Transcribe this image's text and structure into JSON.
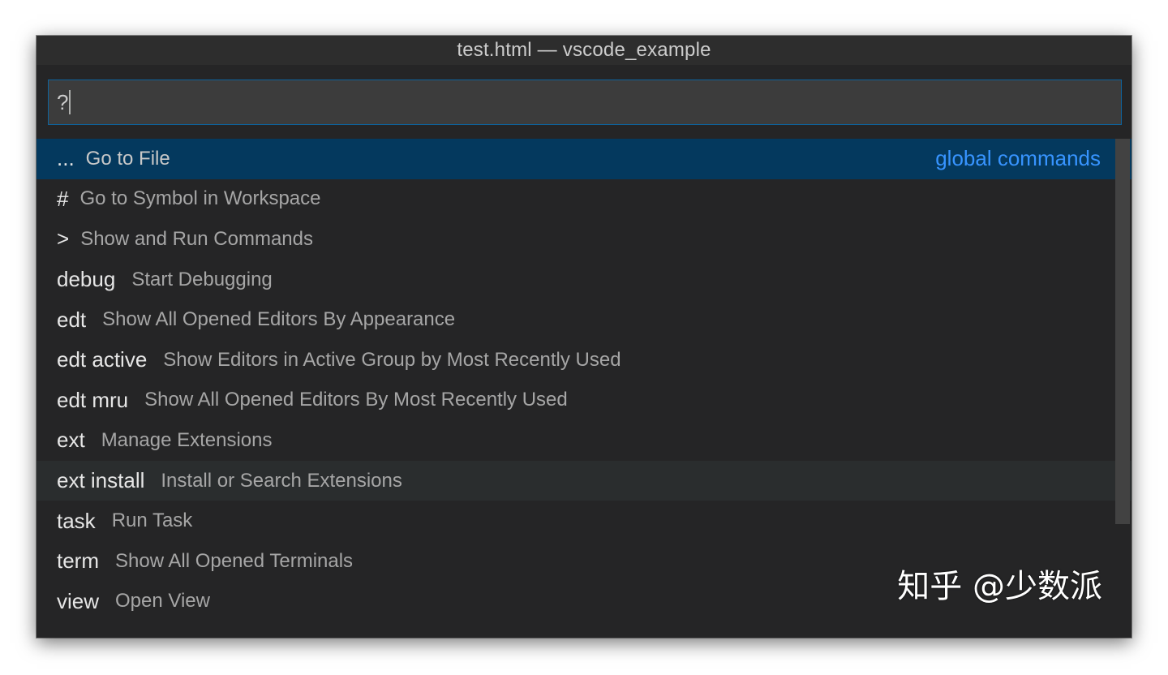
{
  "window": {
    "title": "test.html — vscode_example"
  },
  "quick_open": {
    "input_value": "?",
    "items": [
      {
        "prefix": "...",
        "description": "Go to File",
        "group": "global commands",
        "state": "selected"
      },
      {
        "prefix": "#",
        "description": "Go to Symbol in Workspace",
        "state": "normal"
      },
      {
        "prefix": ">",
        "description": "Show and Run Commands",
        "state": "normal"
      },
      {
        "prefix": "debug",
        "description": "Start Debugging",
        "state": "normal"
      },
      {
        "prefix": "edt",
        "description": "Show All Opened Editors By Appearance",
        "state": "normal"
      },
      {
        "prefix": "edt active",
        "description": "Show Editors in Active Group by Most Recently Used",
        "state": "normal"
      },
      {
        "prefix": "edt mru",
        "description": "Show All Opened Editors By Most Recently Used",
        "state": "normal"
      },
      {
        "prefix": "ext",
        "description": "Manage Extensions",
        "state": "normal"
      },
      {
        "prefix": "ext install",
        "description": "Install or Search Extensions",
        "state": "hover"
      },
      {
        "prefix": "task",
        "description": "Run Task",
        "state": "normal"
      },
      {
        "prefix": "term",
        "description": "Show All Opened Terminals",
        "state": "normal"
      },
      {
        "prefix": "view",
        "description": "Open View",
        "state": "normal"
      }
    ]
  },
  "colors": {
    "accent": "#3794ff",
    "selected_row": "#04395e",
    "hover_row": "#2a2d2e",
    "input_border": "#0e639c"
  },
  "watermark": "知乎 @少数派"
}
